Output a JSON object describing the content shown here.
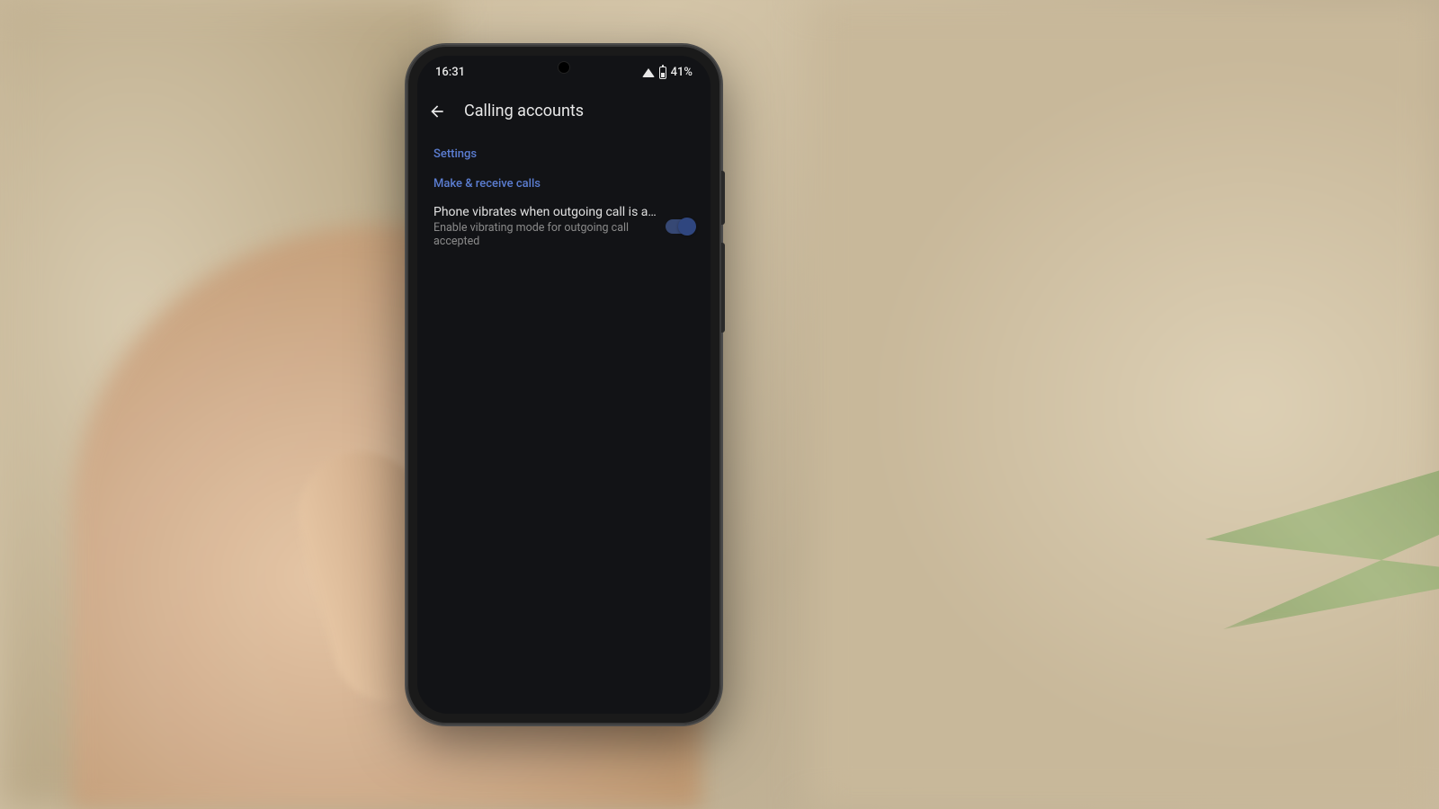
{
  "status_bar": {
    "time": "16:31",
    "battery_text": "41%"
  },
  "header": {
    "title": "Calling accounts"
  },
  "sections": {
    "settings_label": "Settings",
    "make_receive_label": "Make & receive calls"
  },
  "setting_vibrate": {
    "title": "Phone vibrates when outgoing call is accep..",
    "subtitle": "Enable vibrating mode for outgoing call accepted",
    "enabled": true
  }
}
